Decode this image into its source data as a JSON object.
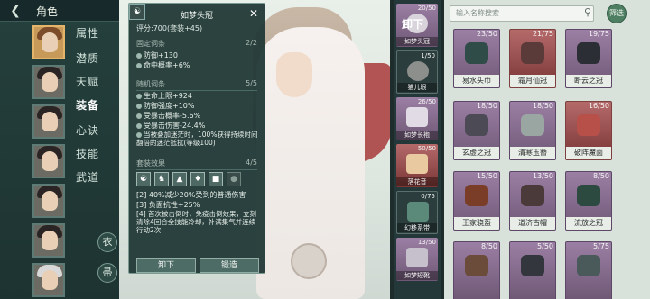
{
  "header": {
    "back_icon": "back-arrow-icon",
    "title": "角色"
  },
  "nav": {
    "items": [
      {
        "label": "属性",
        "active": false
      },
      {
        "label": "潜质",
        "active": false
      },
      {
        "label": "天赋",
        "active": false
      },
      {
        "label": "装备",
        "active": true
      },
      {
        "label": "心诀",
        "active": false
      },
      {
        "label": "技能",
        "active": false
      },
      {
        "label": "武道",
        "active": false
      }
    ],
    "round_buttons": [
      "衣",
      "帚"
    ]
  },
  "tooltip": {
    "title": "如梦头冠",
    "score": "评分:700(套装+45)",
    "fixed": {
      "label": "固定词条",
      "count": "2/2",
      "lines": [
        "防御+130",
        "命中概率+6%"
      ]
    },
    "random": {
      "label": "随机词条",
      "count": "5/5",
      "lines": [
        "生命上限+924",
        "防御强度+10%",
        "受暴击概率-5.6%",
        "受暴击伤害-24.4%"
      ]
    },
    "note": "当被叠加迷茫时，100%获得持续时间翻倍的迷茫抵抗(等级100)",
    "set": {
      "label": "套装效果",
      "count": "4/5",
      "lines": [
        "[2] 40%减少20%受到的普通伤害",
        "[3] 负面抗性+25%",
        "[4] 首次被击倒时，免疫击倒效果，立刻清除4回合全技能冷却，补满集气并连续行动2次"
      ]
    },
    "buttons": {
      "unequip": "卸下",
      "forge": "锻造"
    },
    "close_icon": "close-icon"
  },
  "equipped": [
    {
      "name": "如梦头冠",
      "count": "20/50",
      "overlay": "卸下"
    },
    {
      "name": "猫儿眼",
      "count": "1/50"
    },
    {
      "name": "如梦长袍",
      "count": "26/50"
    },
    {
      "name": "落花音",
      "count": "50/50"
    },
    {
      "name": "幻移系带",
      "count": "0/75"
    },
    {
      "name": "如梦短靴",
      "count": "13/50"
    }
  ],
  "search": {
    "placeholder": "输入名称搜索",
    "filter_label": "筛选"
  },
  "inventory": [
    {
      "name": "易水头巾",
      "count": "23/50",
      "rarity": "purple"
    },
    {
      "name": "霜月仙冠",
      "count": "21/75",
      "rarity": "red"
    },
    {
      "name": "断云之冠",
      "count": "19/75",
      "rarity": "purple"
    },
    {
      "name": "玄虚之冠",
      "count": "18/50",
      "rarity": "purple"
    },
    {
      "name": "清寒玉簪",
      "count": "18/50",
      "rarity": "purple"
    },
    {
      "name": "破阵魔面",
      "count": "16/50",
      "rarity": "red"
    },
    {
      "name": "王家骁盔",
      "count": "15/50",
      "rarity": "purple"
    },
    {
      "name": "道济古帽",
      "count": "13/50",
      "rarity": "purple"
    },
    {
      "name": "流放之冠",
      "count": "8/50",
      "rarity": "purple"
    },
    {
      "name": "",
      "count": "8/50",
      "rarity": "purple"
    },
    {
      "name": "",
      "count": "5/50",
      "rarity": "purple"
    },
    {
      "name": "",
      "count": "5/75",
      "rarity": "purple"
    }
  ]
}
